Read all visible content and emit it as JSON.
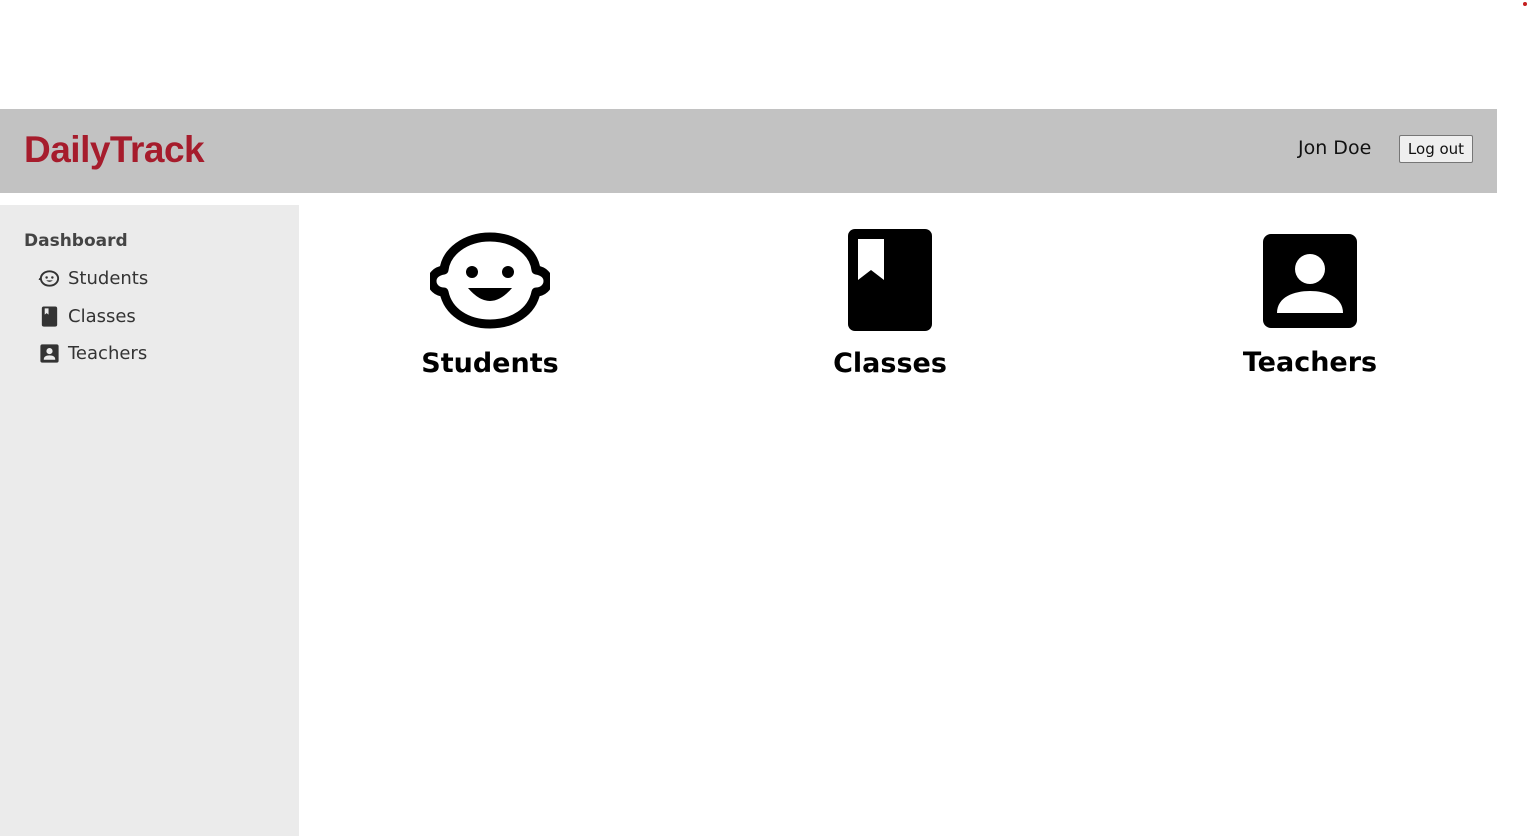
{
  "header": {
    "brand": "DailyTrack",
    "user_name": "Jon Doe",
    "logout_label": "Log out",
    "brand_color": "#a61c2c",
    "background": "#c2c2c2"
  },
  "sidebar": {
    "title": "Dashboard",
    "items": [
      {
        "label": "Students",
        "icon": "baby-face-icon"
      },
      {
        "label": "Classes",
        "icon": "bookmark-book-icon"
      },
      {
        "label": "Teachers",
        "icon": "contact-card-icon"
      }
    ]
  },
  "tiles": [
    {
      "label": "Students",
      "icon": "baby-face-icon"
    },
    {
      "label": "Classes",
      "icon": "bookmark-book-icon"
    },
    {
      "label": "Teachers",
      "icon": "contact-card-icon"
    }
  ]
}
